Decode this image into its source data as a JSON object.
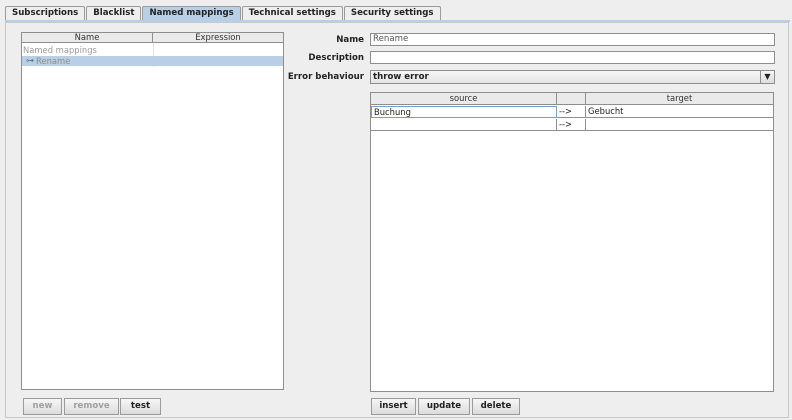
{
  "tabs": [
    {
      "label": "Subscriptions",
      "selected": false
    },
    {
      "label": "Blacklist",
      "selected": false
    },
    {
      "label": "Named mappings",
      "selected": true
    },
    {
      "label": "Technical settings",
      "selected": false
    },
    {
      "label": "Security settings",
      "selected": false
    }
  ],
  "tree": {
    "columns": [
      "Name",
      "Expression"
    ],
    "root_label": "Named mappings",
    "child_label": "Rename"
  },
  "left_buttons": {
    "new": "new",
    "remove": "remove",
    "test": "test"
  },
  "form": {
    "name_label": "Name",
    "name_value": "Rename",
    "description_label": "Description",
    "description_value": "",
    "error_label": "Error behaviour",
    "error_value": "throw error"
  },
  "mapping_table": {
    "columns": [
      "source",
      "",
      "target"
    ],
    "rows": [
      {
        "source": "Buchung",
        "arrow": "-->",
        "target": "Gebucht"
      },
      {
        "source": "",
        "arrow": "-->",
        "target": ""
      }
    ]
  },
  "bottom_buttons": {
    "insert": "insert",
    "update": "update",
    "delete": "delete"
  },
  "colors": {
    "selected_tab": "#b8cfe5",
    "selection": "#b8cfe5",
    "background": "#eeeeee"
  }
}
